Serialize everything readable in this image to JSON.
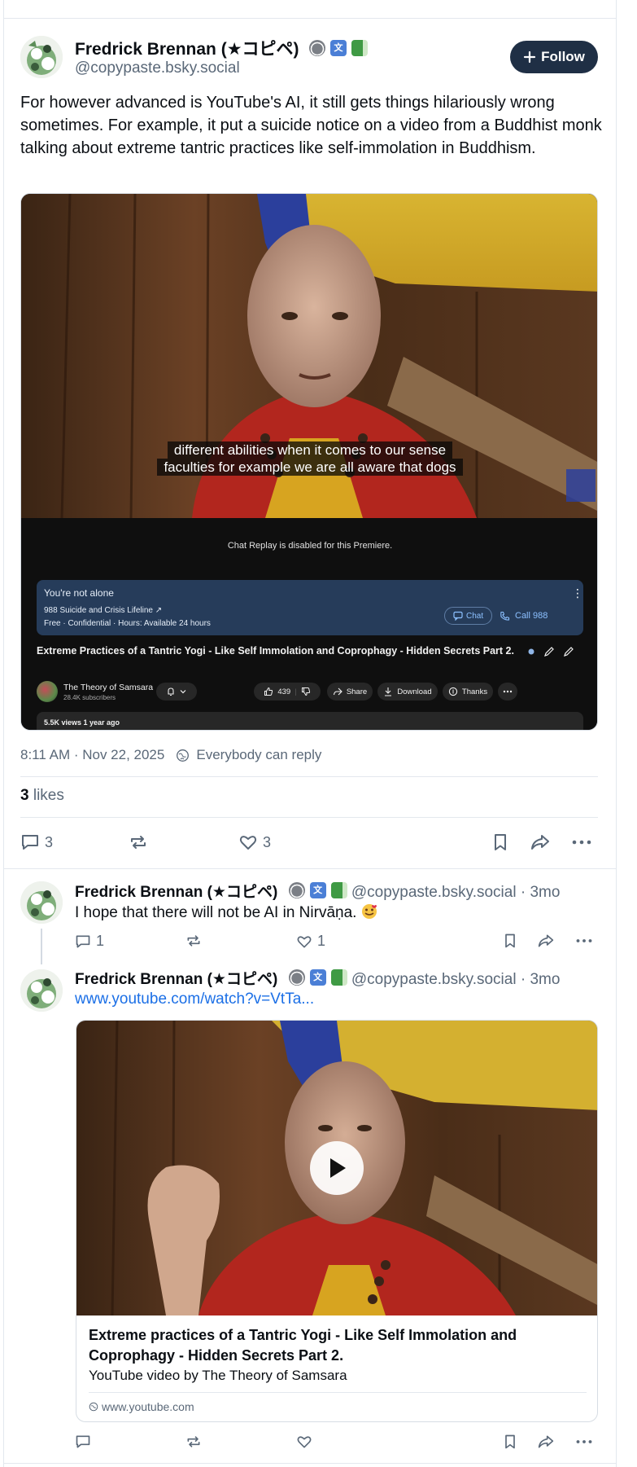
{
  "post": {
    "author_name": "Fredrick Brennan (★コピペ)",
    "author_handle": "@copypaste.bsky.social",
    "follow_label": "Follow",
    "text": "For however advanced is YouTube's AI, it still gets things hilariously wrong sometimes. For example, it put a suicide notice on a video from a Buddhist monk talking about extreme tantric practices like self-immolation in Buddhism.",
    "timestamp": "8:11 AM · Nov 22, 2025",
    "reply_setting": "Everybody can reply",
    "likes_count": "3",
    "likes_label": "likes",
    "reply_count": "3",
    "like_count": "3"
  },
  "screenshot": {
    "caption_line1": "different abilities when it comes to our sense",
    "caption_line2": "faculties for example we are all aware that dogs",
    "chat_note": "Chat Replay is disabled for this Premiere.",
    "banner_title": "You're not alone",
    "banner_line1": "988 Suicide and Crisis Lifeline ↗",
    "banner_line2": "Free · Confidential · Hours: Available 24 hours",
    "chat_label": "Chat",
    "call_label": "Call 988",
    "video_title": "Extreme Practices of a Tantric Yogi - Like Self Immolation and Coprophagy - Hidden Secrets Part 2.",
    "channel_name": "The Theory of Samsara",
    "channel_subs": "28.4K subscribers",
    "like_count": "439",
    "share_label": "Share",
    "download_label": "Download",
    "thanks_label": "Thanks",
    "views": "5.5K views  1 year ago"
  },
  "replies": [
    {
      "author_name": "Fredrick Brennan (★コピペ)",
      "author_handle": "@copypaste.bsky.social",
      "age": "· 3mo",
      "text": "I hope that there will not be AI in Nirvāṇa.",
      "reply_count": "1",
      "like_count": "1"
    },
    {
      "author_name": "Fredrick Brennan (★コピペ)",
      "author_handle": "@copypaste.bsky.social",
      "age": "· 3mo",
      "link_text": "www.youtube.com/watch?v=VtTa...",
      "embed_title": "Extreme practices of a Tantric Yogi - Like  Self Immolation and Coprophagy - Hidden Secrets Part 2.",
      "embed_desc": "YouTube video by The Theory of Samsara",
      "embed_domain": "www.youtube.com"
    }
  ],
  "colors": {
    "follow_bg": "#1f2f45",
    "link": "#1b6fe6",
    "muted_text": "#5a6878",
    "yt_banner": "#263c5a"
  }
}
